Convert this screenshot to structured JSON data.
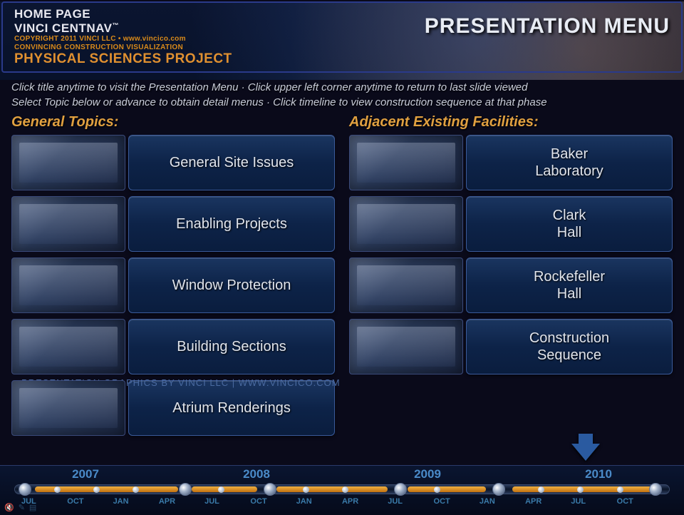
{
  "header": {
    "home": "HOME PAGE",
    "brand": "VINCI CENTNAV",
    "tm": "™",
    "copyright": "COPYRIGHT 2011 VINCI LLC • www.vincico.com",
    "tagline": "CONVINCING CONSTRUCTION VISUALIZATION",
    "project": "PHYSICAL SCIENCES PROJECT",
    "title": "PRESENTATION MENU"
  },
  "instructions": {
    "line1": "Click title anytime to visit the Presentation Menu · Click upper left corner anytime to return to last slide viewed",
    "line2": "Select Topic below or advance to obtain detail menus · Click timeline to view construction sequence at that phase"
  },
  "left": {
    "heading": "General Topics:",
    "items": [
      "General Site Issues",
      "Enabling Projects",
      "Window Protection",
      "Building Sections",
      "Atrium Renderings"
    ]
  },
  "right": {
    "heading": "Adjacent Existing Facilities:",
    "items": [
      "Baker\nLaboratory",
      "Clark\nHall",
      "Rockefeller\nHall",
      "Construction\nSequence"
    ]
  },
  "footer_credit": "PRESENTATION GRAPHICS BY VINCI LLC  |  WWW.VINCICO.COM",
  "timeline": {
    "years": [
      "2007",
      "2008",
      "2009",
      "2010"
    ],
    "months": [
      "JUL",
      "OCT",
      "JAN",
      "APR",
      "JUL",
      "OCT",
      "JAN",
      "APR",
      "JUL",
      "OCT",
      "JAN",
      "APR",
      "JUL",
      "OCT"
    ]
  }
}
